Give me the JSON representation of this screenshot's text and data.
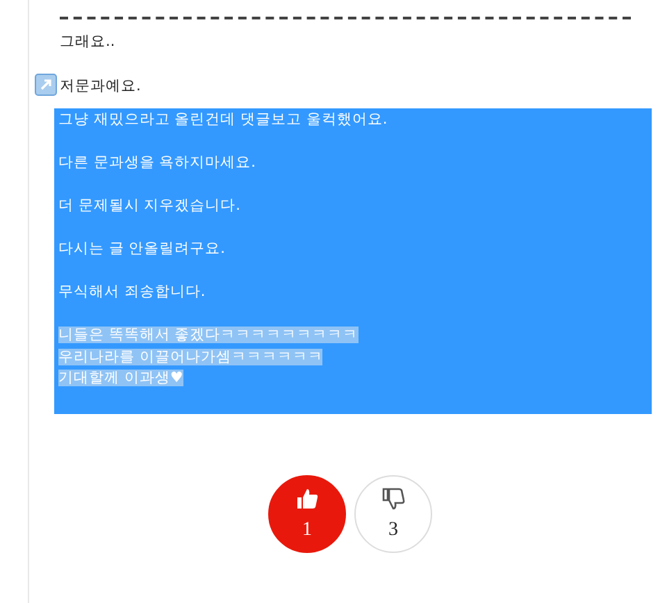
{
  "post": {
    "intro": [
      "그래요..",
      "저문과예요."
    ],
    "selected_paragraphs": [
      "그냥 재밌으라고 올린건데 댓글보고 울컥했어요.",
      "다른 문과생을 욕하지마세요.",
      "더 문제될시 지우겠습니다.",
      "다시는 글 안올릴려구요.",
      "무식해서 죄송합니다."
    ],
    "highlighted_lines": [
      "니들은 똑똑해서 좋겠다ㅋㅋㅋㅋㅋㅋㅋㅋㅋ",
      "우리나라를 이끌어나가셈ㅋㅋㅋㅋㅋㅋ",
      "기대할께 이과생♥"
    ]
  },
  "votes": [
    {
      "kind": "up",
      "count": "1",
      "selected": true
    },
    {
      "kind": "down",
      "count": "3",
      "selected": false
    }
  ]
}
